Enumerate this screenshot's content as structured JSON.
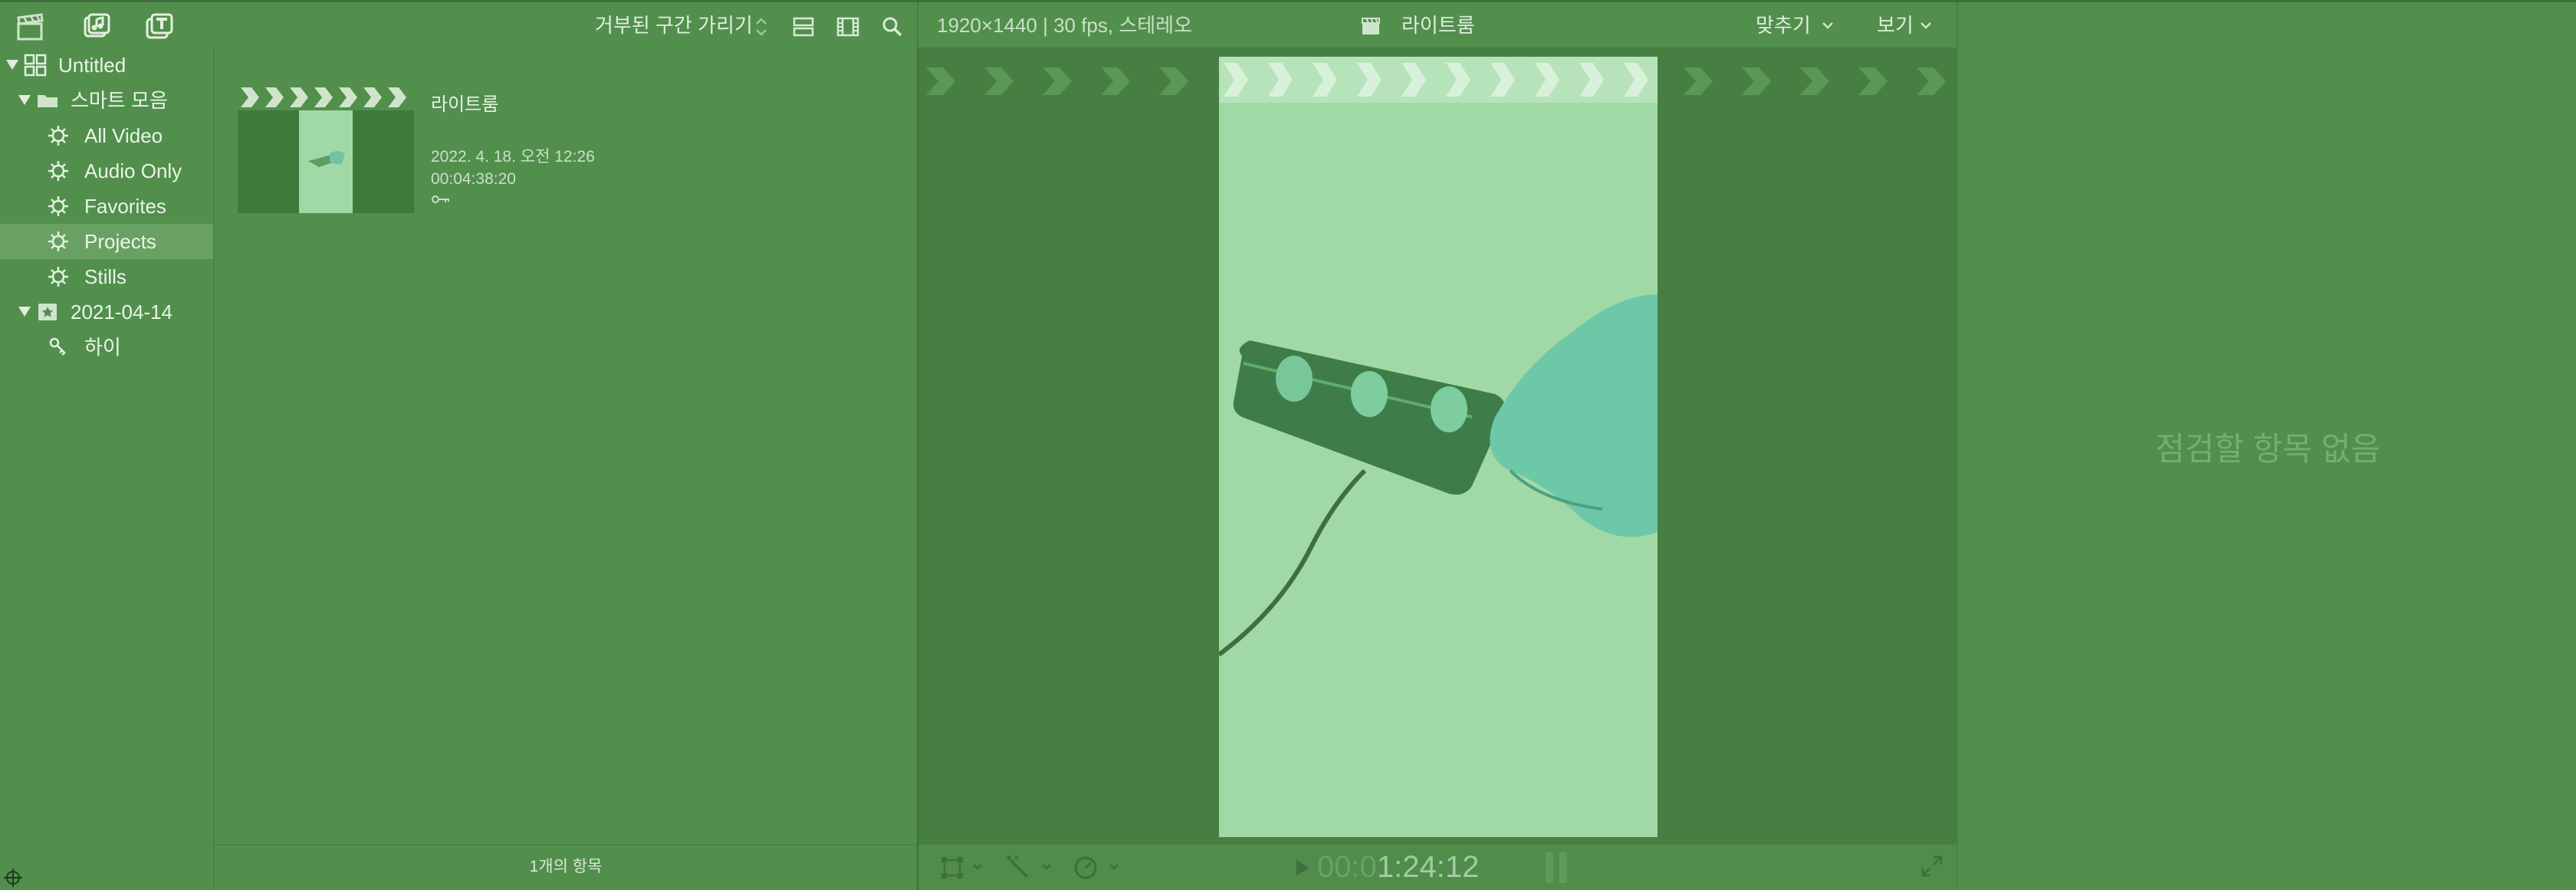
{
  "toolbar": {
    "filter_label": "거부된 구간 가리기",
    "format_info": "1920×1440 | 30 fps, 스테레오",
    "clip_name": "라이트룸",
    "zoom_menu": "맞추기",
    "view_menu": "보기"
  },
  "sidebar": {
    "items": [
      {
        "label": "Untitled"
      },
      {
        "label": "스마트 모음"
      },
      {
        "label": "All Video"
      },
      {
        "label": "Audio Only"
      },
      {
        "label": "Favorites"
      },
      {
        "label": "Projects"
      },
      {
        "label": "Stills"
      },
      {
        "label": "2021-04-14"
      },
      {
        "label": "하이"
      }
    ]
  },
  "browser": {
    "clip": {
      "name": "라이트룸",
      "date": "2022. 4. 18. 오전 12:26",
      "duration": "00:04:38:20",
      "keyword_icon": "key-icon"
    },
    "footer_count": "1개의 항목"
  },
  "viewer": {
    "timecode_dim": "00:0",
    "timecode": "1:24:12"
  },
  "inspector": {
    "empty_message": "점검할 항목 없음"
  },
  "colors": {
    "background": "#528f4d",
    "viewer_bg": "#477f42",
    "selected_row": "#69a163",
    "video_light": "#a1d9a6"
  }
}
